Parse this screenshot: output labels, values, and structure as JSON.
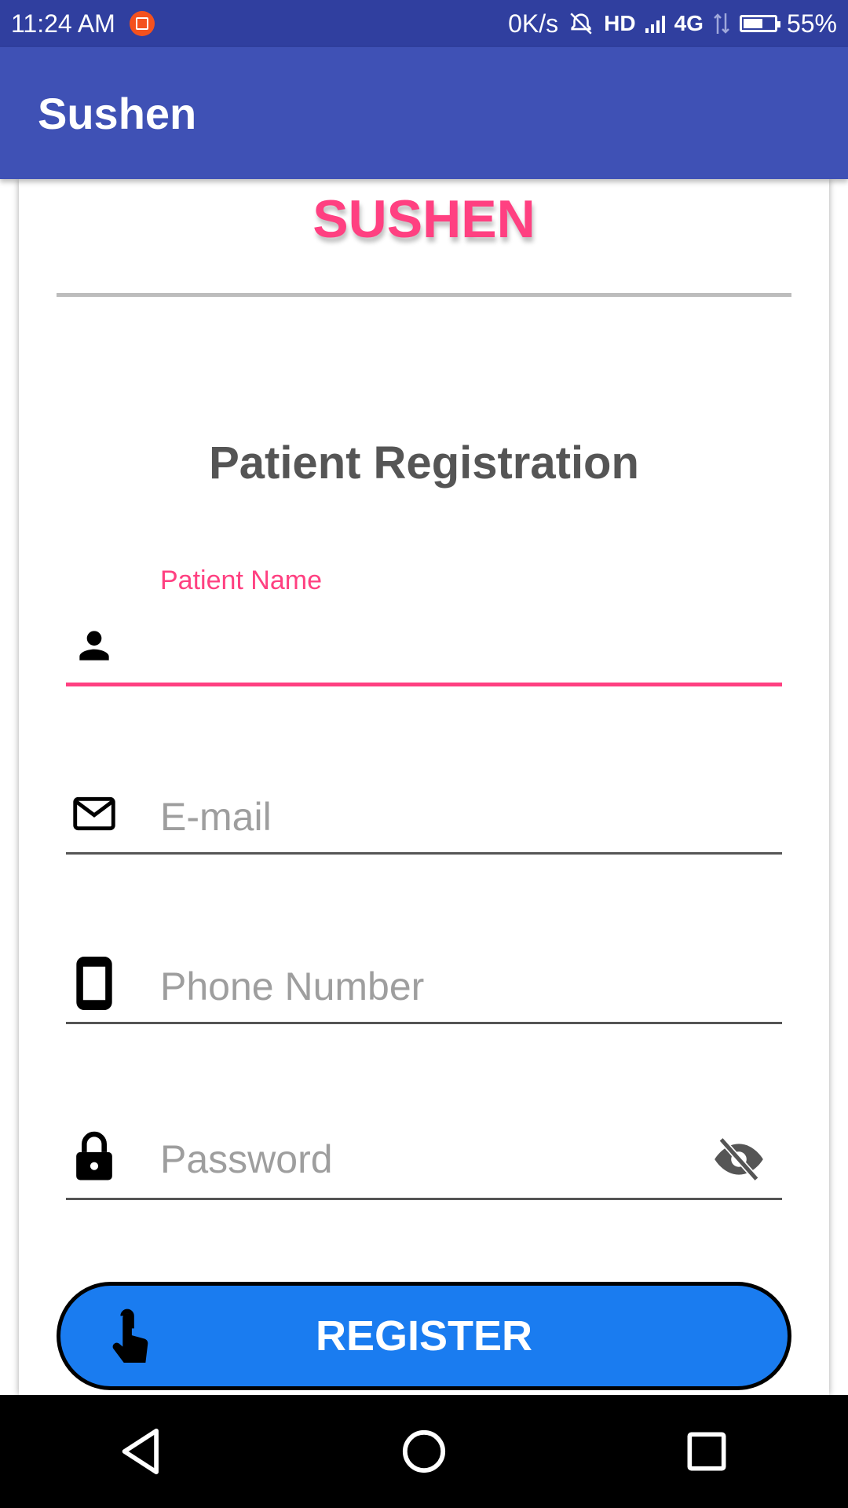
{
  "status_bar": {
    "time": "11:24 AM",
    "speed": "0K/s",
    "hd": "HD",
    "network": "4G",
    "battery_percent": "55%",
    "battery_level": 0.55
  },
  "app_bar": {
    "title": "Sushen"
  },
  "form": {
    "brand": "SUSHEN",
    "heading": "Patient Registration",
    "patient_name": {
      "label": "Patient Name",
      "value": ""
    },
    "email": {
      "placeholder": "E-mail",
      "value": ""
    },
    "phone": {
      "placeholder": "Phone Number",
      "value": ""
    },
    "password": {
      "placeholder": "Password",
      "value": ""
    },
    "register_label": "REGISTER"
  },
  "colors": {
    "status_bar": "#303f9f",
    "app_bar": "#3f51b5",
    "accent": "#ff4081",
    "button": "#1a7cf0"
  },
  "icons": {
    "patient_name": "person-icon",
    "email": "mail-icon",
    "phone": "phone-icon",
    "password": "lock-icon",
    "password_toggle": "eye-off-icon",
    "register": "touch-icon",
    "nav": [
      "back-icon",
      "home-icon",
      "recents-icon"
    ]
  }
}
